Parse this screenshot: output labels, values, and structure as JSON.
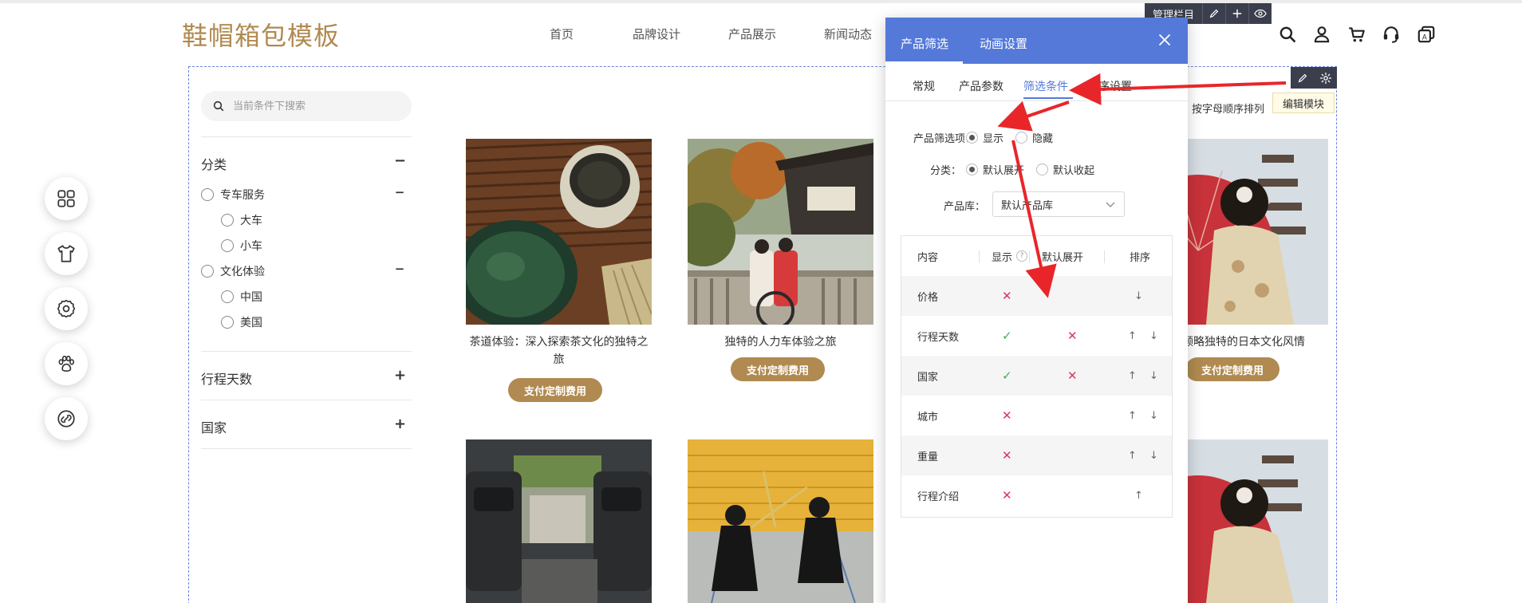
{
  "header": {
    "logo": "鞋帽箱包模板",
    "nav": [
      "首页",
      "品牌设计",
      "产品展示",
      "新闻动态"
    ]
  },
  "admin_bar": {
    "label": "管理栏目"
  },
  "module": {
    "edit_tooltip": "编辑模块"
  },
  "sidebar": {
    "search_placeholder": "当前条件下搜索",
    "categories": {
      "title": "分类",
      "toggle": "−",
      "groups": [
        {
          "label": "专车服务",
          "toggle": "−",
          "children": [
            "大车",
            "小车"
          ]
        },
        {
          "label": "文化体验",
          "toggle": "−",
          "children": [
            "中国",
            "美国"
          ]
        }
      ]
    },
    "days": {
      "title": "行程天数",
      "toggle": "+"
    },
    "country": {
      "title": "国家",
      "toggle": "+"
    }
  },
  "sort_label": "按字母顺序排列",
  "products": [
    {
      "title": "茶道体验：深入探索茶文化的独特之旅",
      "button": "支付定制费用"
    },
    {
      "title": "独特的人力车体验之旅",
      "button": "支付定制费用"
    },
    {
      "title": "领略独特的日本文化风情",
      "button": "支付定制费用"
    }
  ],
  "panel": {
    "tabs": [
      "产品筛选",
      "动画设置"
    ],
    "sub_tabs": [
      "常规",
      "产品参数",
      "筛选条件",
      "排序设置"
    ],
    "filter_label": "产品筛选项：",
    "filter_options": [
      "显示",
      "隐藏"
    ],
    "category_label": "分类：",
    "category_options": [
      "默认展开",
      "默认收起"
    ],
    "library_label": "产品库：",
    "library_value": "默认产品库",
    "table": {
      "headers": [
        "内容",
        "显示",
        "默认展开",
        "排序"
      ],
      "rows": [
        {
          "name": "价格",
          "show": "✕",
          "expand": "",
          "sort": "↓"
        },
        {
          "name": "行程天数",
          "show": "✓",
          "expand": "✕",
          "sort": "↑ ↓"
        },
        {
          "name": "国家",
          "show": "✓",
          "expand": "✕",
          "sort": "↑ ↓"
        },
        {
          "name": "城市",
          "show": "✕",
          "expand": "",
          "sort": "↑ ↓"
        },
        {
          "name": "重量",
          "show": "✕",
          "expand": "",
          "sort": "↑ ↓"
        },
        {
          "name": "行程介绍",
          "show": "✕",
          "expand": "",
          "sort": "↑"
        }
      ]
    }
  },
  "colors": {
    "brand": "#b08a50",
    "panel_blue": "#5479d9",
    "annotation_red": "#e8262a"
  }
}
